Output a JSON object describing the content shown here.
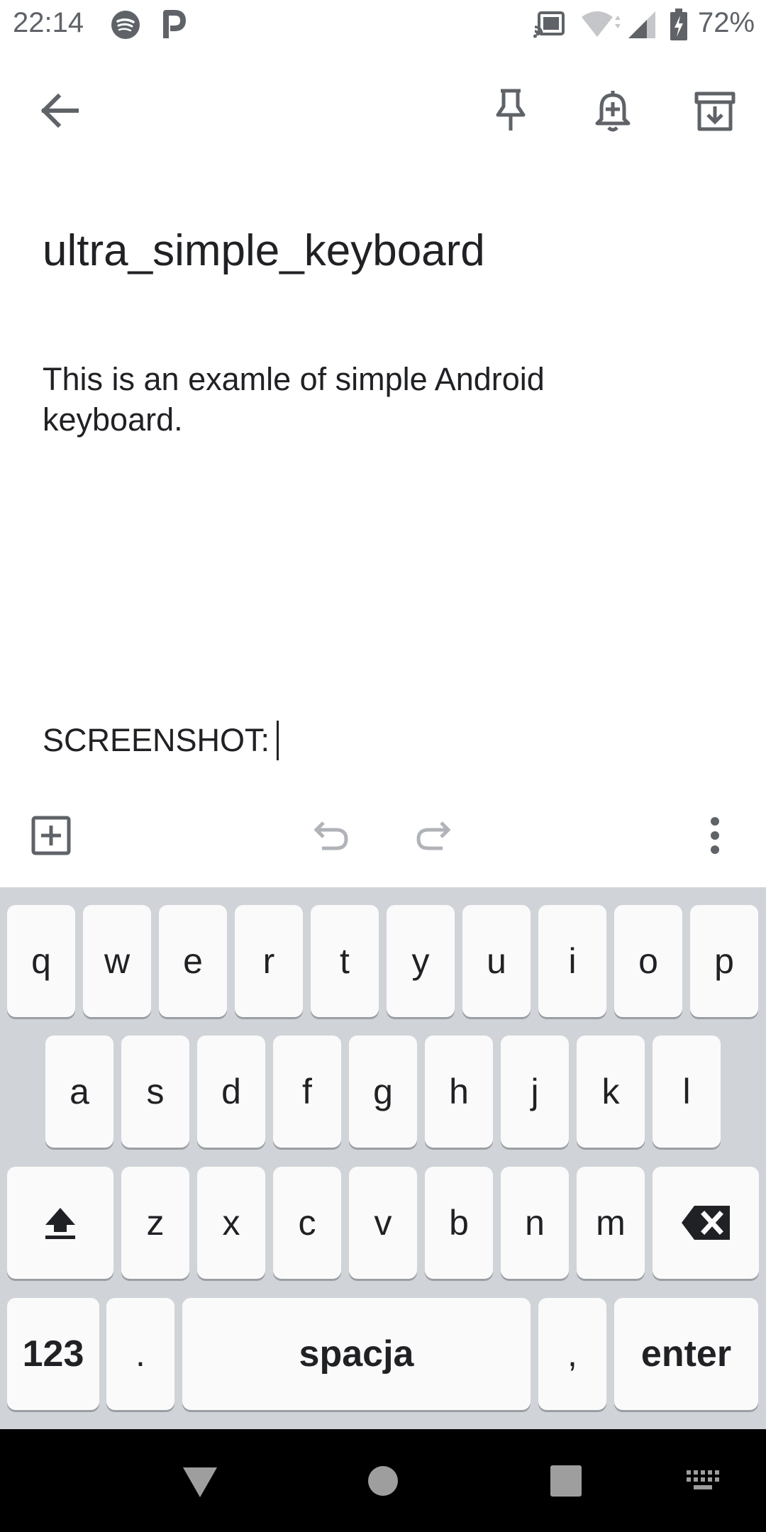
{
  "status_bar": {
    "time": "22:14",
    "battery": "72%",
    "icons": [
      "spotify-icon",
      "p-app-icon",
      "cast-icon",
      "wifi-icon",
      "signal-icon",
      "battery-charging-icon"
    ]
  },
  "toolbar": {
    "icons": [
      "back-arrow-icon",
      "pin-icon",
      "reminder-bell-icon",
      "archive-icon"
    ]
  },
  "note": {
    "title": "ultra_simple_keyboard",
    "body": "This is an examle of simple Android keyboard.",
    "last_line": "SCREENSHOT:"
  },
  "action_bar": {
    "icons": [
      "add-box-icon",
      "undo-icon",
      "redo-icon",
      "more-vert-icon"
    ]
  },
  "keyboard": {
    "row1": [
      "q",
      "w",
      "e",
      "r",
      "t",
      "y",
      "u",
      "i",
      "o",
      "p"
    ],
    "row2": [
      "a",
      "s",
      "d",
      "f",
      "g",
      "h",
      "j",
      "k",
      "l"
    ],
    "row3": [
      "z",
      "x",
      "c",
      "v",
      "b",
      "n",
      "m"
    ],
    "row4": {
      "numbers": "123",
      "period": ".",
      "space": "spacja",
      "comma": ",",
      "enter": "enter"
    },
    "colors": {
      "background": "#d0d3d8",
      "key": "#fafafa"
    }
  },
  "nav_bar": {
    "icons": [
      "back-triangle-icon",
      "home-circle-icon",
      "recents-square-icon",
      "keyboard-switch-icon"
    ]
  }
}
